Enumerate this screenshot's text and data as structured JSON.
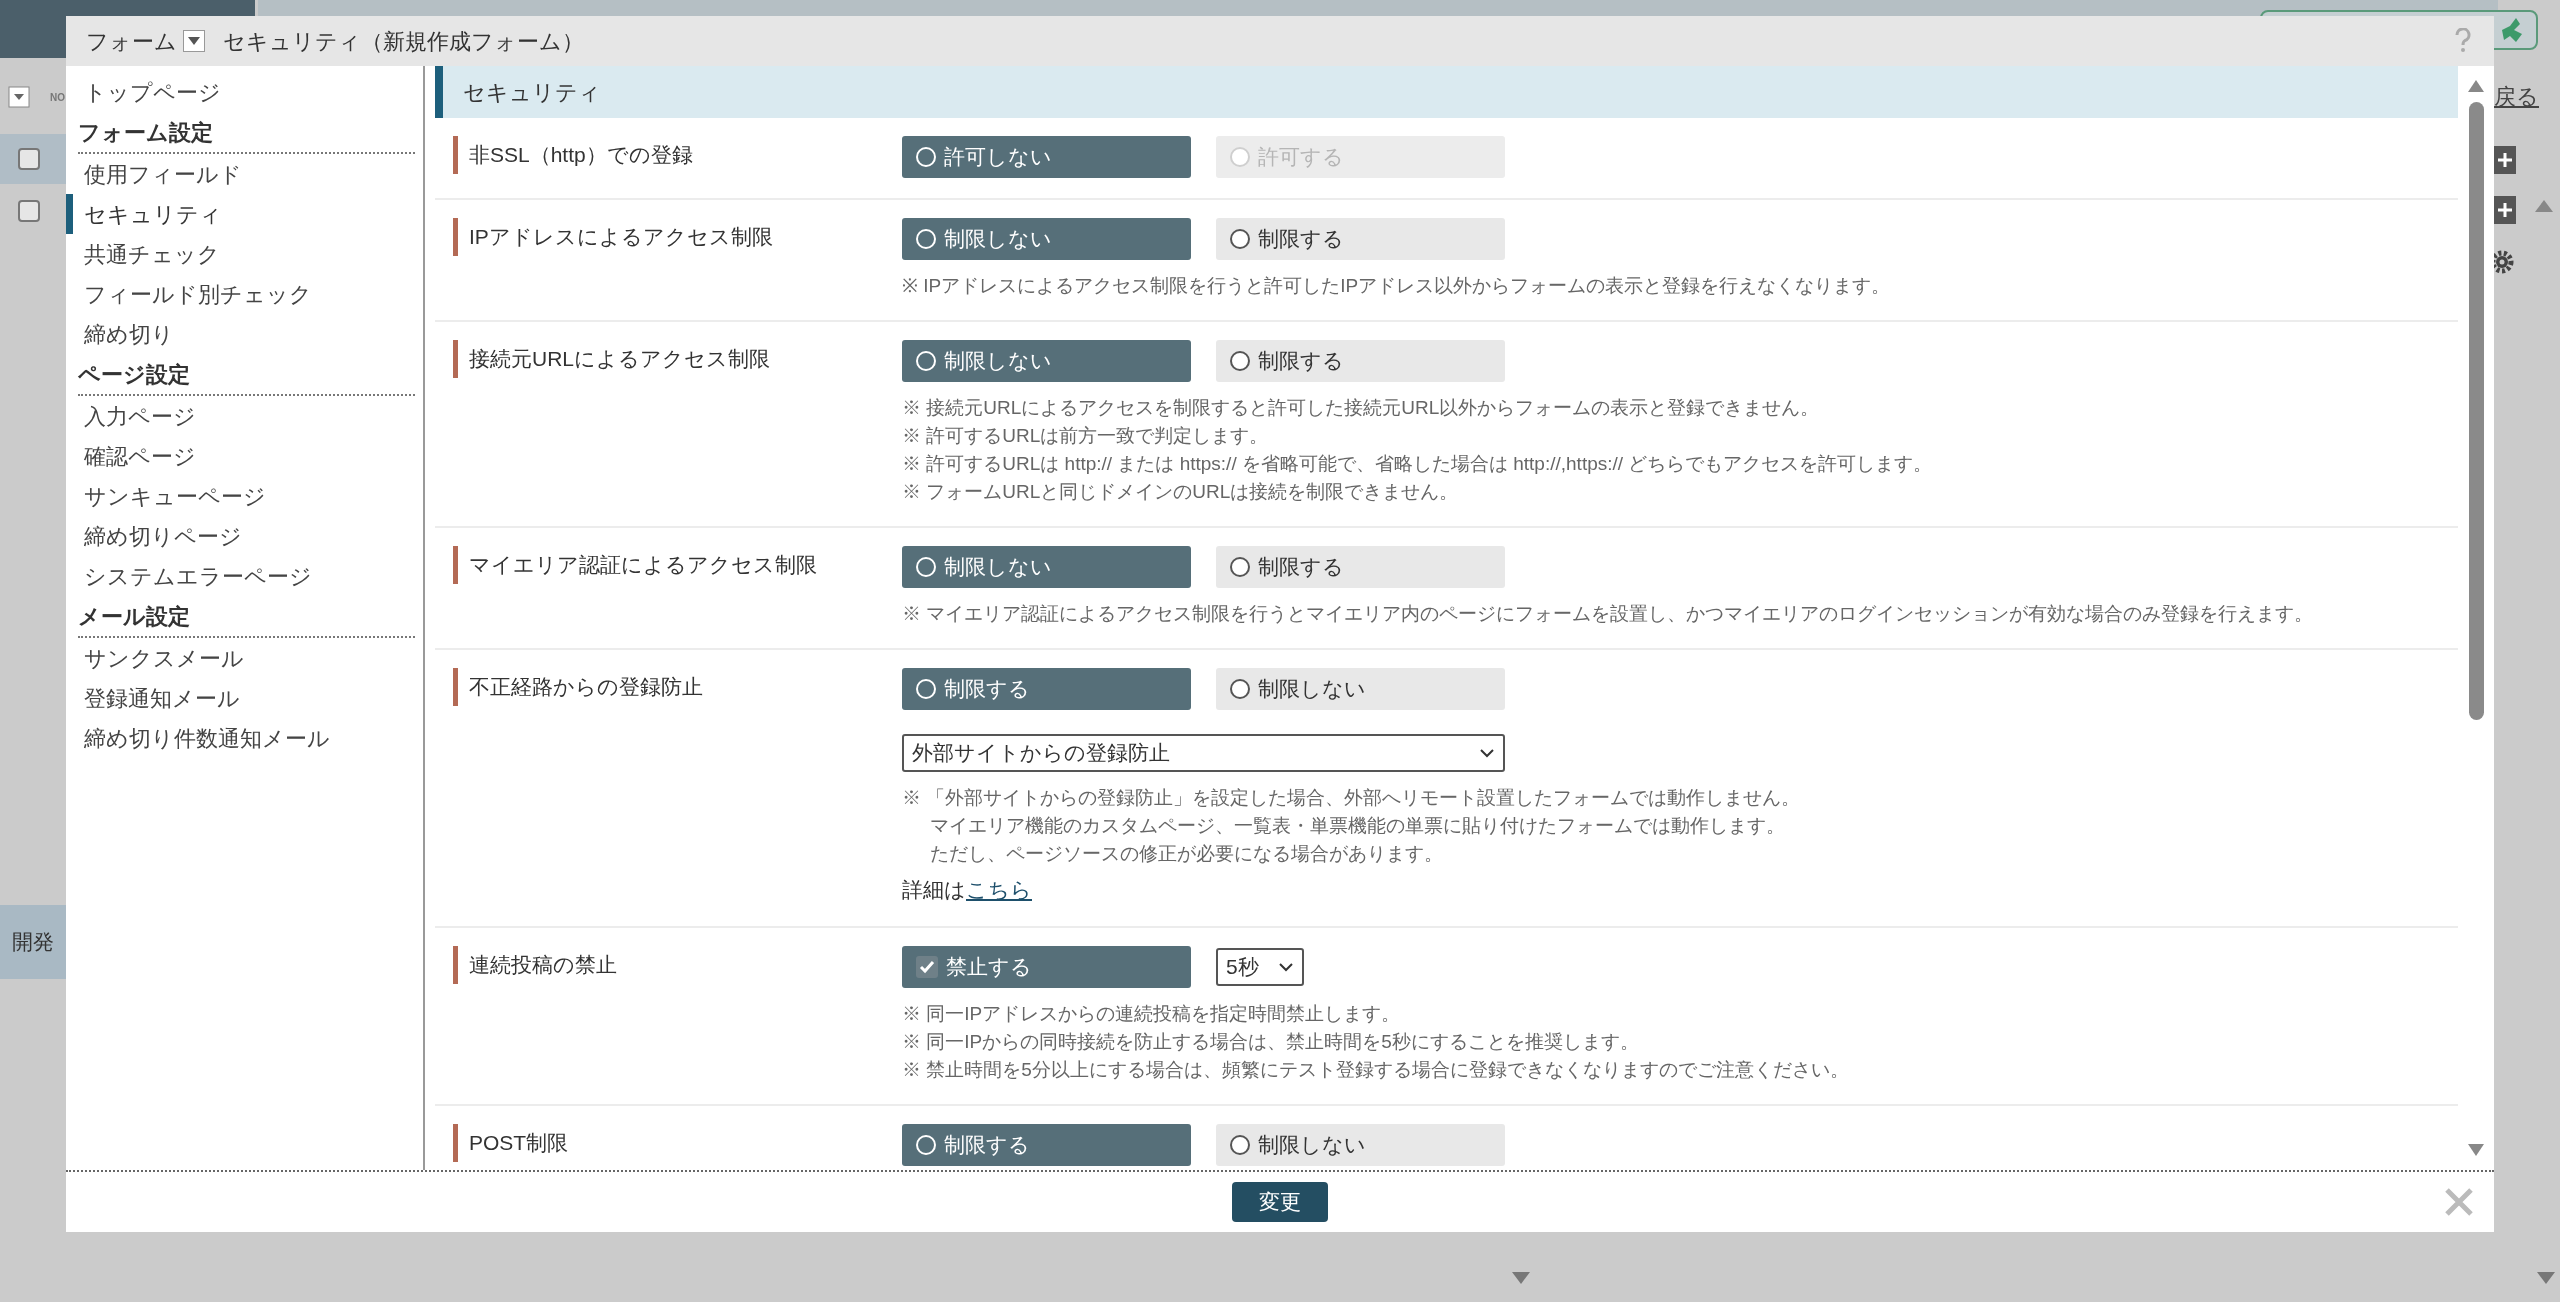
{
  "backdrop": {
    "column_label": "NO",
    "rows": [
      {
        "checked": false
      },
      {
        "checked": false
      }
    ],
    "tab": "開発",
    "link": "戻る"
  },
  "dialog": {
    "menu_label": "フォーム",
    "title": "セキュリティ（新規作成フォーム）"
  },
  "sidebar": {
    "top": {
      "label": "トップページ",
      "selected": false
    },
    "groups": [
      {
        "heading": "フォーム設定",
        "items": [
          {
            "label": "使用フィールド",
            "selected": false
          },
          {
            "label": "セキュリティ",
            "selected": true
          },
          {
            "label": "共通チェック",
            "selected": false
          },
          {
            "label": "フィールド別チェック",
            "selected": false
          },
          {
            "label": "締め切り",
            "selected": false
          }
        ]
      },
      {
        "heading": "ページ設定",
        "items": [
          {
            "label": "入力ページ",
            "selected": false
          },
          {
            "label": "確認ページ",
            "selected": false
          },
          {
            "label": "サンキューページ",
            "selected": false
          },
          {
            "label": "締め切りページ",
            "selected": false
          },
          {
            "label": "システムエラーページ",
            "selected": false
          }
        ]
      },
      {
        "heading": "メール設定",
        "items": [
          {
            "label": "サンクスメール",
            "selected": false
          },
          {
            "label": "登録通知メール",
            "selected": false
          },
          {
            "label": "締め切り件数通知メール",
            "selected": false
          }
        ]
      }
    ]
  },
  "section_title": "セキュリティ",
  "settings": [
    {
      "label": "非SSL（http）での登録",
      "control": {
        "kind": "radio",
        "options": [
          {
            "label": "許可しない",
            "selected": true,
            "disabled": false
          },
          {
            "label": "許可する",
            "selected": false,
            "disabled": true
          }
        ]
      }
    },
    {
      "label": "IPアドレスによるアクセス制限",
      "control": {
        "kind": "radio",
        "options": [
          {
            "label": "制限しない",
            "selected": true,
            "disabled": false
          },
          {
            "label": "制限する",
            "selected": false,
            "disabled": false
          }
        ]
      },
      "notes": [
        {
          "kind": "note",
          "text": "※ IPアドレスによるアクセス制限を行うと許可したIPアドレス以外からフォームの表示と登録を行えなくなります。"
        }
      ]
    },
    {
      "label": "接続元URLによるアクセス制限",
      "control": {
        "kind": "radio",
        "options": [
          {
            "label": "制限しない",
            "selected": true,
            "disabled": false
          },
          {
            "label": "制限する",
            "selected": false,
            "disabled": false
          }
        ]
      },
      "notes": [
        {
          "kind": "note",
          "text": "※ 接続元URLによるアクセスを制限すると許可した接続元URL以外からフォームの表示と登録できません。"
        },
        {
          "kind": "note",
          "text": "※ 許可するURLは前方一致で判定します。"
        },
        {
          "kind": "note",
          "text": "※ 許可するURLは http:// または https:// を省略可能で、省略した場合は http://,https:// どちらでもアクセスを許可します。"
        },
        {
          "kind": "note",
          "text": "※ フォームURLと同じドメインのURLは接続を制限できません。"
        }
      ]
    },
    {
      "label": "マイエリア認証によるアクセス制限",
      "control": {
        "kind": "radio",
        "options": [
          {
            "label": "制限しない",
            "selected": true,
            "disabled": false
          },
          {
            "label": "制限する",
            "selected": false,
            "disabled": false
          }
        ]
      },
      "notes": [
        {
          "kind": "note",
          "text": "※ マイエリア認証によるアクセス制限を行うとマイエリア内のページにフォームを設置し、かつマイエリアのログインセッションが有効な場合のみ登録を行えます。"
        }
      ]
    },
    {
      "label": "不正経路からの登録防止",
      "control": {
        "kind": "radio",
        "options": [
          {
            "label": "制限する",
            "selected": true,
            "disabled": false
          },
          {
            "label": "制限しない",
            "selected": false,
            "disabled": false
          }
        ]
      },
      "select": {
        "value": "外部サイトからの登録防止"
      },
      "notes": [
        {
          "kind": "note",
          "text": "※ 「外部サイトからの登録防止」を設定した場合、外部へリモート設置したフォームでは動作しません。"
        },
        {
          "kind": "continued",
          "text": "マイエリア機能のカスタムページ、一覧表・単票機能の単票に貼り付けたフォームでは動作します。"
        },
        {
          "kind": "continued",
          "text": "ただし、ページソースの修正が必要になる場合があります。"
        }
      ],
      "detail": {
        "text": "詳細は",
        "link": "こちら"
      }
    },
    {
      "label": "連続投稿の禁止",
      "control": {
        "kind": "checkbox",
        "label": "禁止する",
        "checked": true
      },
      "interval": {
        "value": "5秒"
      },
      "notes": [
        {
          "kind": "note",
          "text": "※ 同一IPアドレスからの連続投稿を指定時間禁止します。"
        },
        {
          "kind": "note",
          "text": "※ 同一IPからの同時接続を防止する場合は、禁止時間を5秒にすることを推奨します。"
        },
        {
          "kind": "note",
          "text": "※ 禁止時間を5分以上にする場合は、頻繁にテスト登録する場合に登録できなくなりますのでご注意ください。"
        }
      ]
    },
    {
      "label": "POST制限",
      "control": {
        "kind": "radio",
        "options": [
          {
            "label": "制限する",
            "selected": true,
            "disabled": false
          },
          {
            "label": "制限しない",
            "selected": false,
            "disabled": false
          }
        ]
      }
    }
  ],
  "footer": {
    "button": "変更"
  }
}
